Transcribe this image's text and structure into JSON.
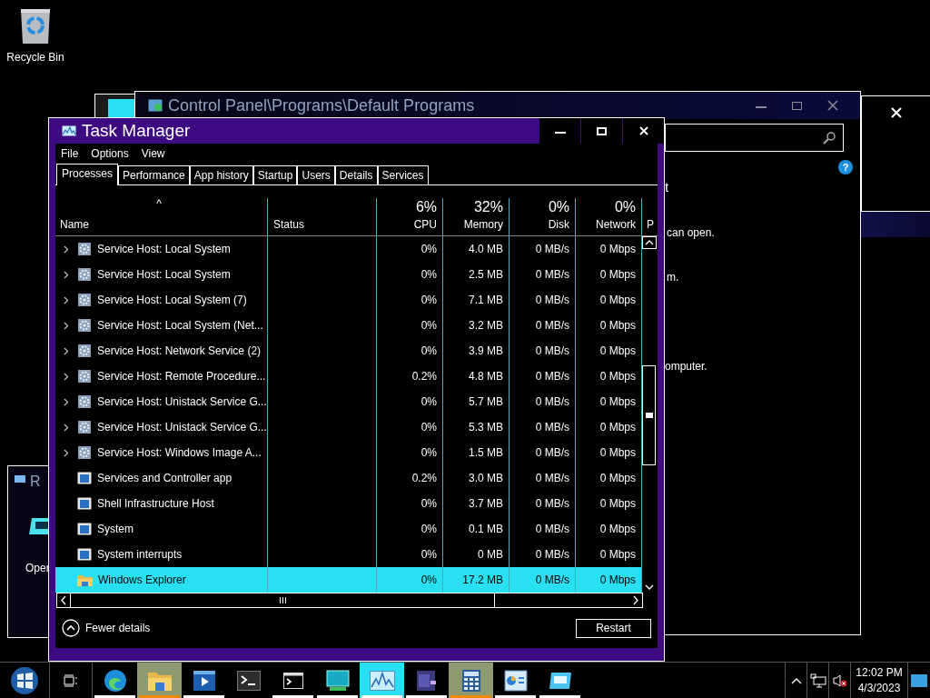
{
  "desktop": {
    "icons": [
      {
        "label": "Recycle Bin"
      }
    ]
  },
  "control_panel": {
    "title": "Control Panel\\Programs\\Default Programs",
    "help": "?",
    "fragments": [
      "t",
      "can open.",
      "m.",
      "omputer."
    ]
  },
  "left_window": {
    "title": "R",
    "text": "Oper"
  },
  "task_manager": {
    "title": "Task Manager",
    "menu": [
      "File",
      "Options",
      "View"
    ],
    "tabs": [
      {
        "label": "Processes",
        "selected": true
      },
      {
        "label": "Performance",
        "selected": false
      },
      {
        "label": "App history",
        "selected": false
      },
      {
        "label": "Startup",
        "selected": false
      },
      {
        "label": "Users",
        "selected": false
      },
      {
        "label": "Details",
        "selected": false
      },
      {
        "label": "Services",
        "selected": false
      }
    ],
    "sort_arrow": "^",
    "columns": [
      {
        "label": "Name"
      },
      {
        "label": "Status"
      },
      {
        "label": "CPU",
        "percent": "6%"
      },
      {
        "label": "Memory",
        "percent": "32%"
      },
      {
        "label": "Disk",
        "percent": "0%"
      },
      {
        "label": "Network",
        "percent": "0%"
      },
      {
        "label": "P"
      }
    ],
    "rows": [
      {
        "kind": "service",
        "expandable": true,
        "selected": false,
        "name": "Service Host: Local System",
        "cpu": "0%",
        "memory": "4.0 MB",
        "disk": "0 MB/s",
        "network": "0 Mbps"
      },
      {
        "kind": "service",
        "expandable": true,
        "selected": false,
        "name": "Service Host: Local System",
        "cpu": "0%",
        "memory": "2.5 MB",
        "disk": "0 MB/s",
        "network": "0 Mbps"
      },
      {
        "kind": "service",
        "expandable": true,
        "selected": false,
        "name": "Service Host: Local System (7)",
        "cpu": "0%",
        "memory": "7.1 MB",
        "disk": "0 MB/s",
        "network": "0 Mbps"
      },
      {
        "kind": "service",
        "expandable": true,
        "selected": false,
        "name": "Service Host: Local System (Net...",
        "cpu": "0%",
        "memory": "3.2 MB",
        "disk": "0 MB/s",
        "network": "0 Mbps"
      },
      {
        "kind": "service",
        "expandable": true,
        "selected": false,
        "name": "Service Host: Network Service (2)",
        "cpu": "0%",
        "memory": "3.9 MB",
        "disk": "0 MB/s",
        "network": "0 Mbps"
      },
      {
        "kind": "service",
        "expandable": true,
        "selected": false,
        "name": "Service Host: Remote Procedure...",
        "cpu": "0.2%",
        "memory": "4.8 MB",
        "disk": "0 MB/s",
        "network": "0 Mbps"
      },
      {
        "kind": "service",
        "expandable": true,
        "selected": false,
        "name": "Service Host: Unistack Service G...",
        "cpu": "0%",
        "memory": "5.7 MB",
        "disk": "0 MB/s",
        "network": "0 Mbps"
      },
      {
        "kind": "service",
        "expandable": true,
        "selected": false,
        "name": "Service Host: Unistack Service G...",
        "cpu": "0%",
        "memory": "5.3 MB",
        "disk": "0 MB/s",
        "network": "0 Mbps"
      },
      {
        "kind": "service",
        "expandable": true,
        "selected": false,
        "name": "Service Host: Windows Image A...",
        "cpu": "0%",
        "memory": "1.5 MB",
        "disk": "0 MB/s",
        "network": "0 Mbps"
      },
      {
        "kind": "app",
        "expandable": false,
        "selected": false,
        "name": "Services and Controller app",
        "cpu": "0.2%",
        "memory": "3.0 MB",
        "disk": "0 MB/s",
        "network": "0 Mbps"
      },
      {
        "kind": "app",
        "expandable": false,
        "selected": false,
        "name": "Shell Infrastructure Host",
        "cpu": "0%",
        "memory": "3.7 MB",
        "disk": "0 MB/s",
        "network": "0 Mbps"
      },
      {
        "kind": "app",
        "expandable": false,
        "selected": false,
        "name": "System",
        "cpu": "0%",
        "memory": "0.1 MB",
        "disk": "0 MB/s",
        "network": "0 Mbps"
      },
      {
        "kind": "app",
        "expandable": false,
        "selected": false,
        "name": "System interrupts",
        "cpu": "0%",
        "memory": "0 MB",
        "disk": "0 MB/s",
        "network": "0 Mbps"
      },
      {
        "kind": "folder",
        "expandable": false,
        "selected": true,
        "name": "Windows Explorer",
        "cpu": "0%",
        "memory": "17.2 MB",
        "disk": "0 MB/s",
        "network": "0 Mbps"
      }
    ],
    "fewer_details": "Fewer details",
    "restart": "Restart"
  },
  "taskbar": {
    "apps": [
      {
        "kind": "edge",
        "running": true,
        "flashing": false,
        "selected": false
      },
      {
        "kind": "explorer",
        "running": true,
        "flashing": true,
        "selected": false
      },
      {
        "kind": "media",
        "running": true,
        "flashing": false,
        "selected": false
      },
      {
        "kind": "terminal",
        "running": false,
        "flashing": false,
        "selected": false
      },
      {
        "kind": "cmd",
        "running": true,
        "flashing": false,
        "selected": false
      },
      {
        "kind": "remote",
        "running": true,
        "flashing": false,
        "selected": false
      },
      {
        "kind": "taskmgr",
        "running": true,
        "flashing": false,
        "selected": true
      },
      {
        "kind": "onenote",
        "running": true,
        "flashing": false,
        "selected": false
      },
      {
        "kind": "calculator",
        "running": true,
        "flashing": true,
        "selected": false
      },
      {
        "kind": "controlpanel",
        "running": true,
        "flashing": false,
        "selected": false
      },
      {
        "kind": "window",
        "running": true,
        "flashing": false,
        "selected": false
      }
    ],
    "time": "12:02 PM",
    "date": "4/3/2023"
  }
}
